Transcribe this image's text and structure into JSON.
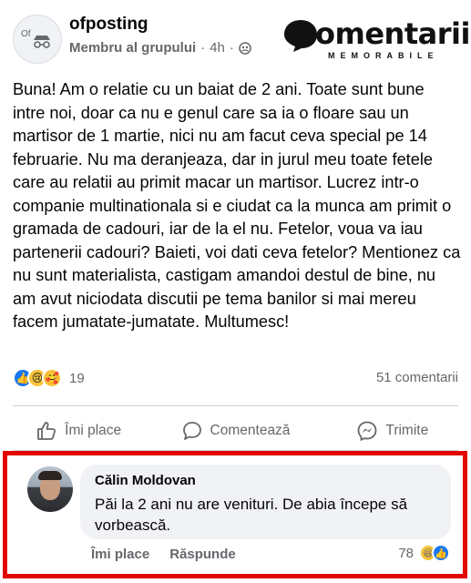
{
  "post": {
    "author": "ofposting",
    "avatar_label": "Of",
    "role": "Membru al grupului",
    "separator": "·",
    "time": "4h",
    "separator2": "·",
    "text": "Buna! Am o relatie cu un baiat de 2 ani. Toate sunt bune intre noi, doar ca nu e genul care sa ia o floare sau un martisor de 1 martie, nici nu am facut ceva special pe 14 februarie. Nu ma deranjeaza, dar in jurul meu toate fetele care au relatii au primit macar un martisor. Lucrez intr-o companie multinationala si e ciudat ca la munca am primit o gramada de cadouri, iar de la el nu. Fetelor, voua va iau partenerii cadouri? Baieti, voi dati ceva fetelor? Mentionez ca nu sunt materialista, castigam amandoi destul de bine, nu am avut niciodata discutii pe tema banilor si mai mereu facem jumatate-jumatate. Multumesc!",
    "reaction_count": "19",
    "comments_count": "51 comentarii",
    "reaction_icons": [
      "like-icon",
      "sad-icon",
      "care-icon"
    ]
  },
  "watermark": {
    "main": "omentarii",
    "sub": "MEMORABILE"
  },
  "actions": {
    "like": "Îmi place",
    "comment": "Comentează",
    "share": "Trimite"
  },
  "comment": {
    "author": "Călin Moldovan",
    "text": "Păi la 2 ani nu are venituri. De abia începe să vorbească.",
    "like": "Îmi place",
    "reply": "Răspunde",
    "reaction_count": "78",
    "reaction_icons": [
      "haha-icon",
      "like-icon"
    ]
  },
  "colors": {
    "highlight_border": "#e10600",
    "like_blue": "#1877f2",
    "meta_gray": "#65676b",
    "bubble_bg": "#f0f2f5"
  }
}
